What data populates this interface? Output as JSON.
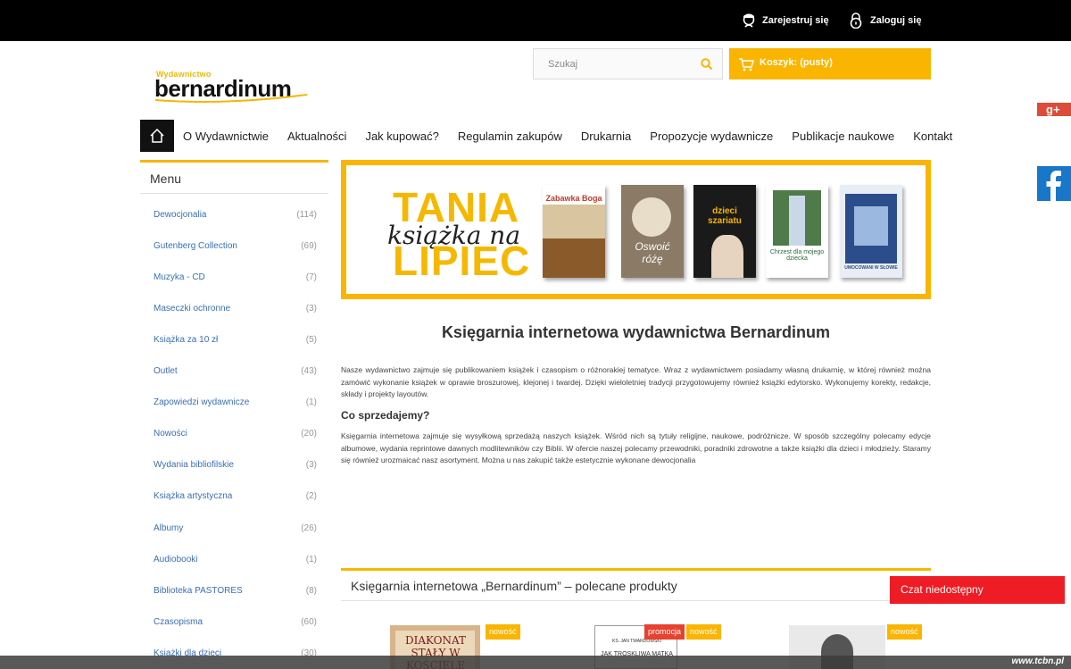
{
  "topbar": {
    "register_label": "Zarejestruj się",
    "login_label": "Zaloguj się"
  },
  "logo": {
    "small": "Wydawnictwo",
    "big": "bernardinum"
  },
  "search": {
    "placeholder": "Szukaj"
  },
  "cart": {
    "label": "Koszyk: (pusty)"
  },
  "nav": {
    "items": [
      "O Wydawnictwie",
      "Aktualności",
      "Jak kupować?",
      "Regulamin zakupów",
      "Drukarnia",
      "Propozycje wydawnicze",
      "Publikacje naukowe",
      "Kontakt"
    ]
  },
  "sidebar": {
    "title": "Menu",
    "categories": [
      {
        "name": "Dewocjonalia",
        "count": "(114)"
      },
      {
        "name": "Gutenberg Collection",
        "count": "(69)"
      },
      {
        "name": "Muzyka - CD",
        "count": "(7)"
      },
      {
        "name": "Maseczki ochronne",
        "count": "(3)"
      },
      {
        "name": "Książka za 10 zł",
        "count": "(5)"
      },
      {
        "name": "Outlet",
        "count": "(43)"
      },
      {
        "name": "Zapowiedzi wydawnicze",
        "count": "(1)"
      },
      {
        "name": "Nowości",
        "count": "(20)"
      },
      {
        "name": "Wydania bibliofilskie",
        "count": "(3)"
      },
      {
        "name": "Książka artystyczna",
        "count": "(2)"
      },
      {
        "name": "Albumy",
        "count": "(26)"
      },
      {
        "name": "Audiobooki",
        "count": "(1)"
      },
      {
        "name": "Biblioteka PASTORES",
        "count": "(8)"
      },
      {
        "name": "Czasopisma",
        "count": "(60)"
      },
      {
        "name": "Książki dla dzieci",
        "count": "(30)"
      }
    ]
  },
  "banner": {
    "line1": "TANIA",
    "line2": "książka na",
    "line3": "LIPIEC",
    "books": [
      {
        "title": "Zabawka Boga",
        "color": "#c23a2a"
      },
      {
        "title": "Oswoić różę",
        "color": "#8a7a66"
      },
      {
        "title": "dzieci szariatu",
        "color": "#1a1a1a"
      },
      {
        "title": "Chrzest dla mojego dziecka",
        "color": "#4f7a4a"
      },
      {
        "title": "UMOCOWANI W SŁOWIE",
        "color": "#2c4d8c"
      }
    ]
  },
  "main": {
    "heading": "Księgarnia internetowa wydawnictwa Bernardinum",
    "para1": "Nasze wydawnictwo zajmuje się publikowaniem książek i czasopism o różnorakiej tematyce. Wraz z wydawnictwem posiadamy własną drukarnię, w której również można zamówić wykonanie książek w oprawie broszurowej, klejonej i twardej. Dzięki wieloletniej tradycji przygotowujemy również książki edytorsko. Wykonujemy korekty, redakcje, składy i projekty layoutów.",
    "subheading": "Co sprzedajemy?",
    "para2": "Księgarnia internetowa zajmuje się wysyłkową sprzedażą naszych książek. Wśród nich są tytuły religijne, naukowe, podróżnicze.  W sposób szczególny polecamy edycje albumowe, wydania reprintowe dawnych modlitewników czy Biblii. W ofercie naszej polecamy przewodniki, poradniki zdrowotne a także książki dla dzieci i młodzieży. Staramy się również urozmaicać nasz asortyment. Można u nas zakupić także estetycznie wykonane dewocjonalia"
  },
  "recommended": {
    "title": "Księgarnia internetowa „Bernardinum” – polecane produkty",
    "badge_new": "nowość",
    "badge_promo": "promocja",
    "product1_text": "DIAKONAT STAŁY W KOŚCIELE",
    "product2_author": "KS. JAN TWARDOWSKI",
    "product2_text": "JAK TROSKLIWA MATKA"
  },
  "widgets": {
    "gplus": "g+",
    "chat": "Czat niedostępny"
  },
  "footer": {
    "watermark": "www.tcbn.pl"
  }
}
